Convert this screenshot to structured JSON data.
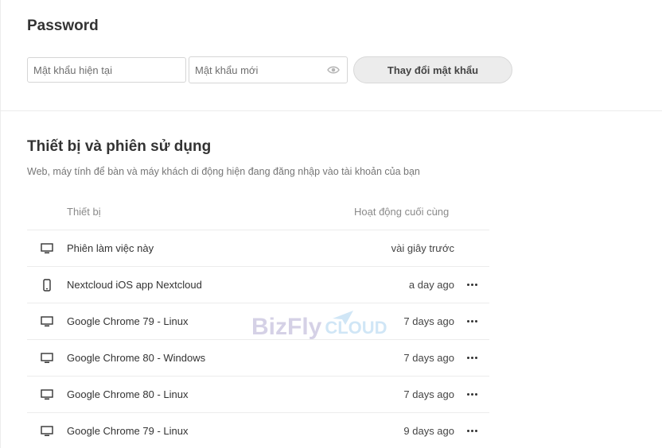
{
  "password": {
    "title": "Password",
    "current_placeholder": "Mật khẩu hiện tại",
    "new_placeholder": "Mật khẩu mới",
    "change_button": "Thay đổi mật khẩu"
  },
  "devices": {
    "title": "Thiết bị và phiên sử dụng",
    "description": "Web, máy tính để bàn và máy khách di động hiện đang đăng nhập vào tài khoản của bạn",
    "columns": {
      "device": "Thiết bị",
      "last_activity": "Hoạt động cuối cùng"
    },
    "rows": [
      {
        "icon": "desktop-icon",
        "name": "Phiên làm việc này",
        "time": "vài giây trước",
        "has_menu": false
      },
      {
        "icon": "phone-icon",
        "name": "Nextcloud iOS app Nextcloud",
        "time": "a day ago",
        "has_menu": true
      },
      {
        "icon": "desktop-icon",
        "name": "Google Chrome 79 - Linux",
        "time": "7 days ago",
        "has_menu": true
      },
      {
        "icon": "desktop-icon",
        "name": "Google Chrome 80 - Windows",
        "time": "7 days ago",
        "has_menu": true
      },
      {
        "icon": "desktop-icon",
        "name": "Google Chrome 80 - Linux",
        "time": "7 days ago",
        "has_menu": true
      },
      {
        "icon": "desktop-icon",
        "name": "Google Chrome 79 - Linux",
        "time": "9 days ago",
        "has_menu": true
      }
    ]
  },
  "watermark": {
    "brand": "BizFly",
    "suffix": "CLOUD"
  }
}
